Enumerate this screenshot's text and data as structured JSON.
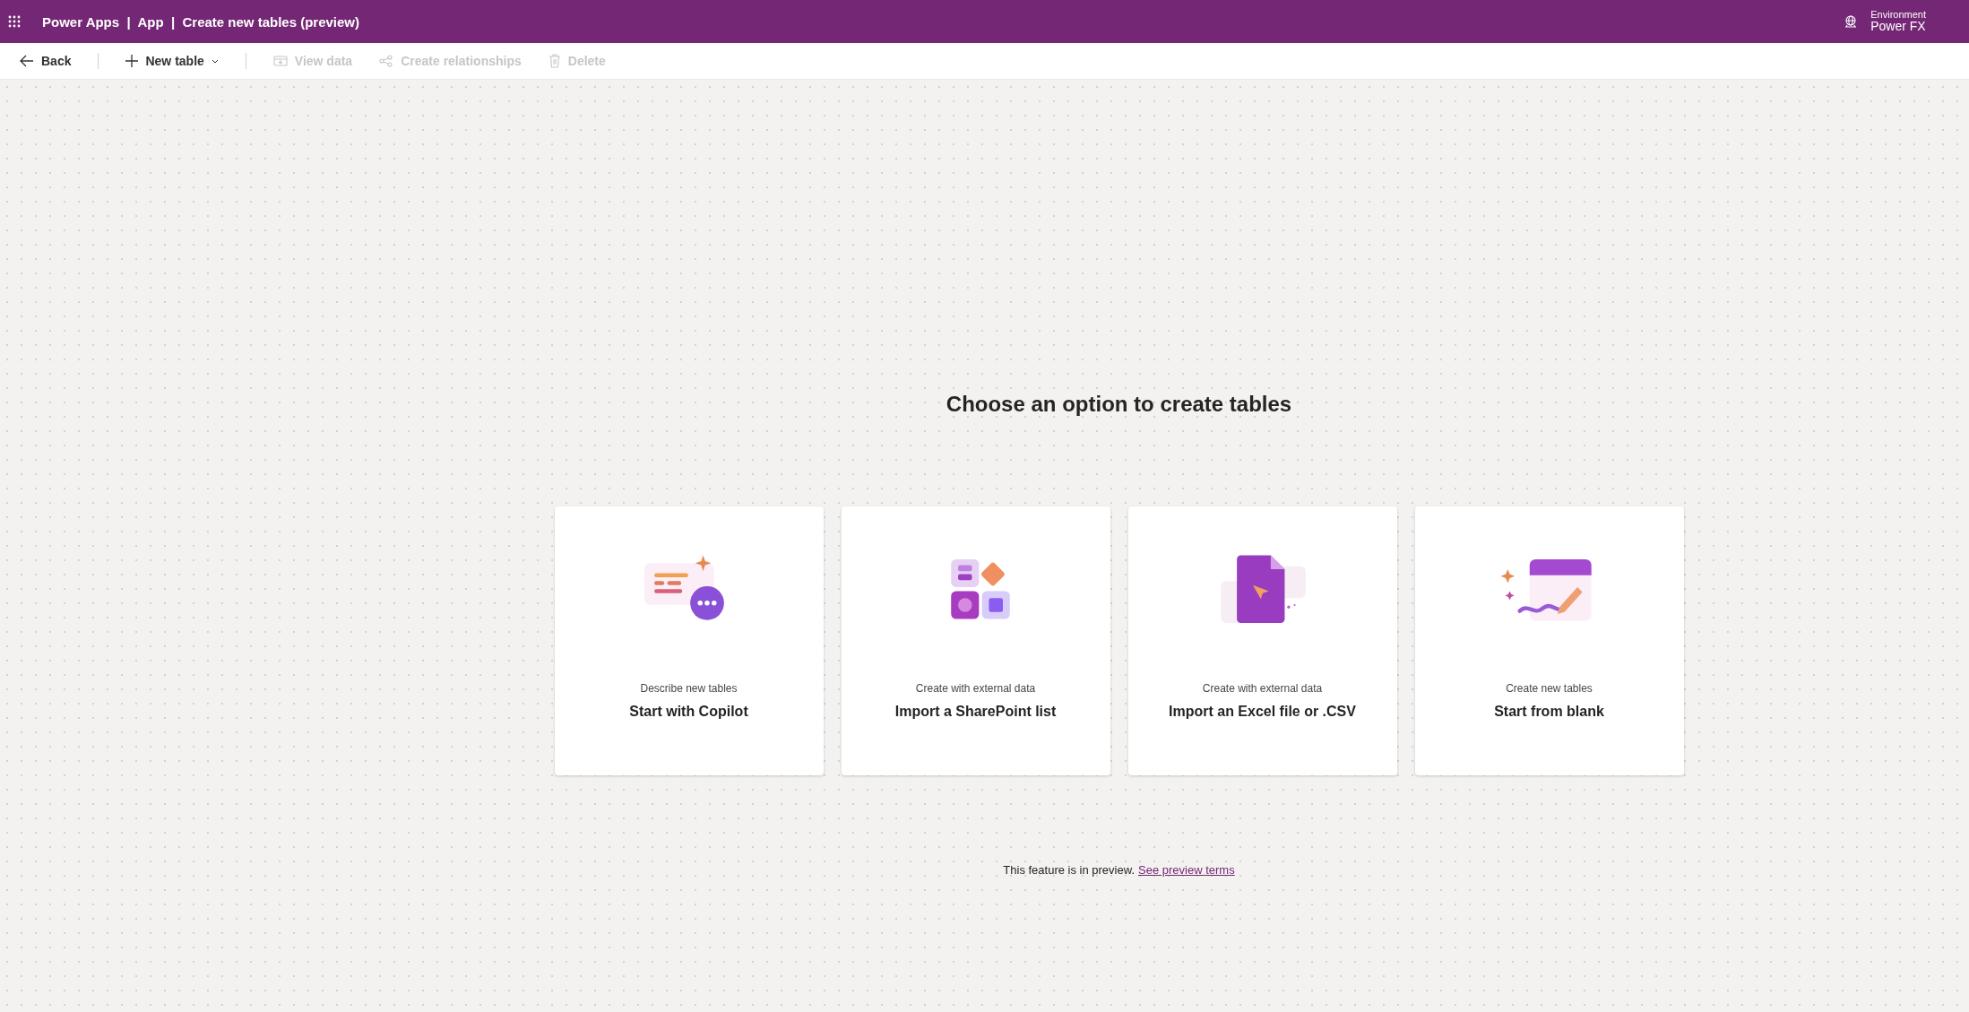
{
  "header": {
    "title": "Power Apps  |  App  |  Create new tables (preview)",
    "environment_label": "Environment",
    "environment_name": "Power FX"
  },
  "toolbar": [
    {
      "kind": "back",
      "label": "Back",
      "disabled": false
    },
    {
      "kind": "new",
      "label": "New table",
      "disabled": false
    },
    {
      "kind": "view",
      "label": "View data",
      "disabled": true
    },
    {
      "kind": "relations",
      "label": "Create relationships",
      "disabled": true
    },
    {
      "kind": "delete",
      "label": "Delete",
      "disabled": true
    }
  ],
  "heading": "Choose an option to create tables",
  "options": [
    {
      "kind": "copilot",
      "caption": "Describe new tables",
      "title": "Start with Copilot"
    },
    {
      "kind": "sharepoint",
      "caption": "Create with external data",
      "title": "Import a SharePoint list"
    },
    {
      "kind": "excel",
      "caption": "Create with external data",
      "title": "Import an Excel file or .CSV"
    },
    {
      "kind": "blank",
      "caption": "Create new tables",
      "title": "Start from blank"
    }
  ],
  "notice": {
    "text": "This feature is in preview.",
    "link": "See preview terms"
  }
}
